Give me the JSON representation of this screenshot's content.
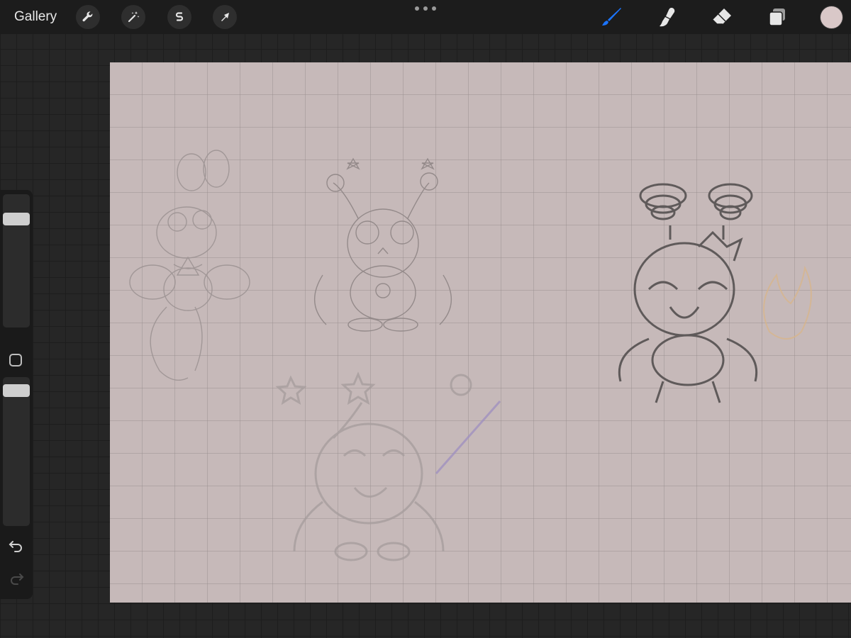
{
  "app": {
    "gallery_label": "Gallery"
  },
  "toolbar": {
    "left_tools": [
      "wrench-icon",
      "magic-wand-icon",
      "selection-s-icon",
      "transform-arrow-icon"
    ],
    "right_tools": [
      "brush-icon",
      "smudge-icon",
      "eraser-icon",
      "layers-icon"
    ],
    "active_tool": "brush",
    "active_tool_color": "#1b74ff",
    "current_color": "#d9c8c8"
  },
  "sidebar": {
    "brush_size_level": 0.85,
    "opacity_level": 0.95,
    "icons": [
      "modify-square-icon",
      "undo-icon",
      "redo-icon"
    ]
  },
  "canvas": {
    "background_color": "#c6b9b9",
    "grid": true
  }
}
